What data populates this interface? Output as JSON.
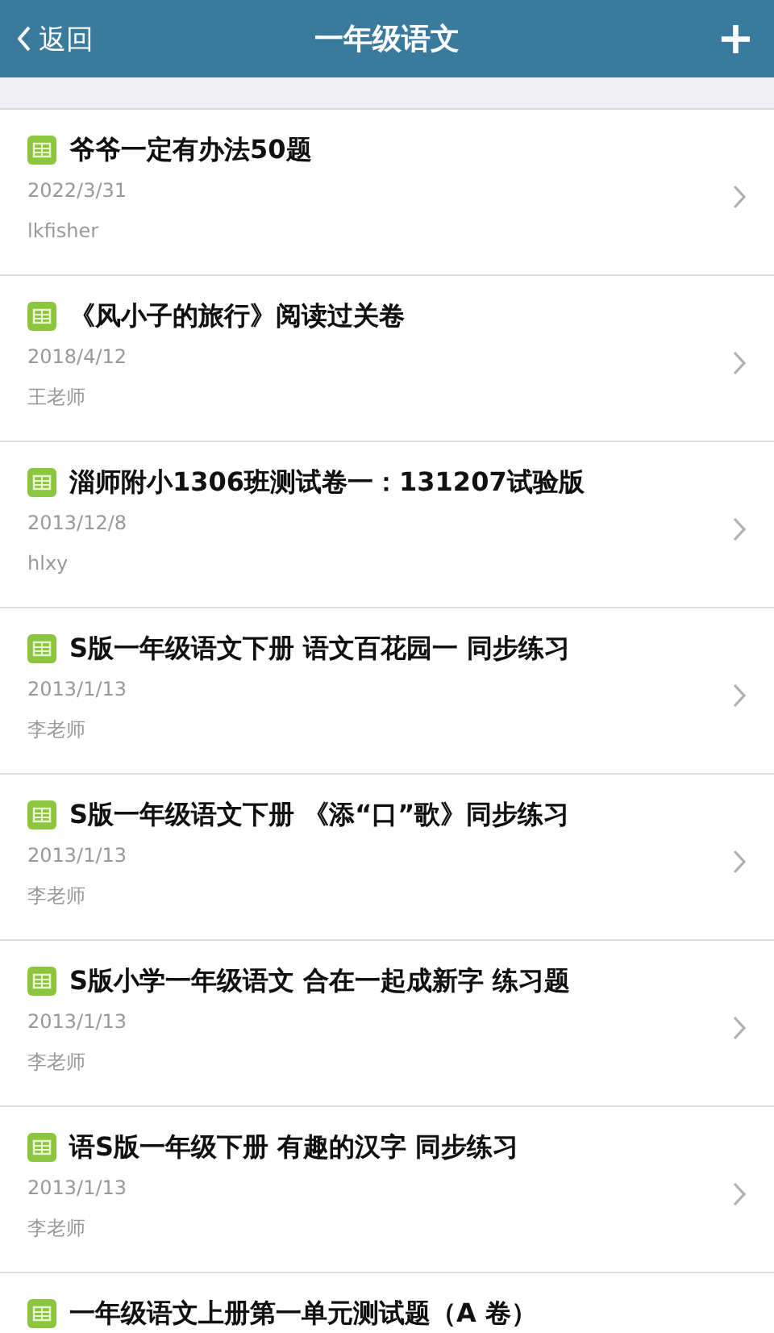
{
  "header": {
    "back": "返回",
    "title": "一年级语文",
    "add": "+"
  },
  "items": [
    {
      "title": "爷爷一定有办法50题",
      "date": "2022/3/31",
      "author": "lkfisher"
    },
    {
      "title": "《风小子的旅行》阅读过关卷",
      "date": "2018/4/12",
      "author": "王老师"
    },
    {
      "title": "淄师附小1306班测试卷一：131207试验版",
      "date": "2013/12/8",
      "author": "hlxy"
    },
    {
      "title": "S版一年级语文下册 语文百花园一 同步练习",
      "date": "2013/1/13",
      "author": "李老师"
    },
    {
      "title": "S版一年级语文下册 《添“口”歌》同步练习",
      "date": "2013/1/13",
      "author": "李老师"
    },
    {
      "title": "S版小学一年级语文 合在一起成新字 练习题",
      "date": "2013/1/13",
      "author": "李老师"
    },
    {
      "title": "语S版一年级下册 有趣的汉字 同步练习",
      "date": "2013/1/13",
      "author": "李老师"
    },
    {
      "title": "一年级语文上册第一单元测试题（A 卷）"
    }
  ]
}
